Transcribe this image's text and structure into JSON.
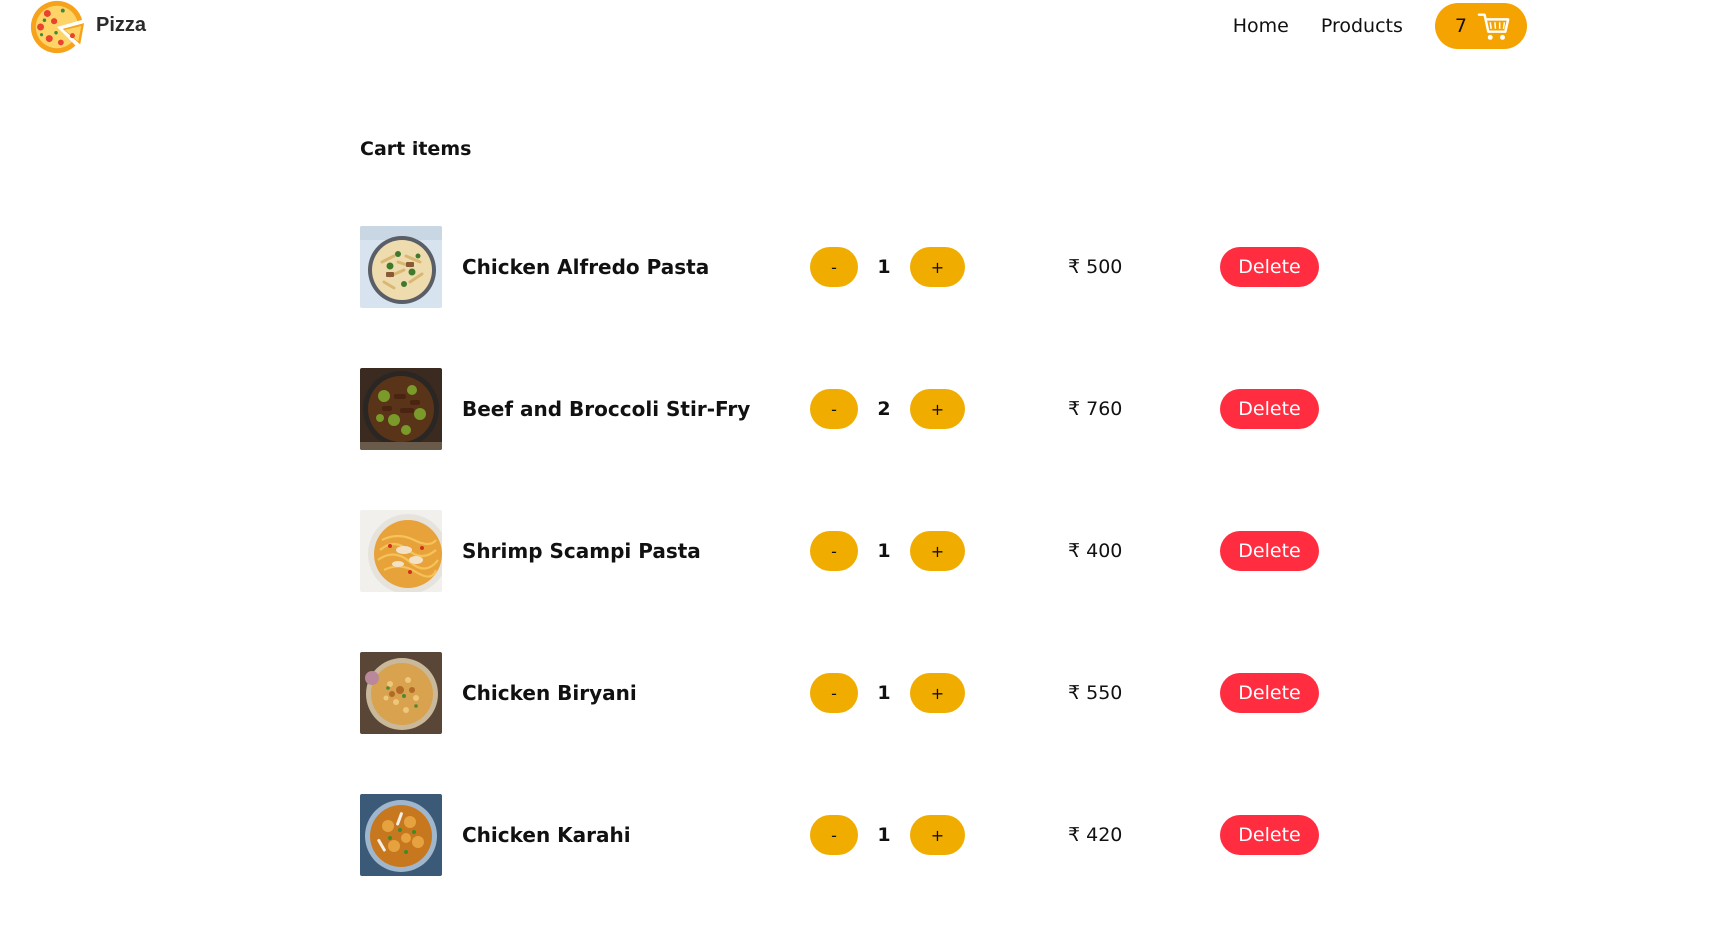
{
  "header": {
    "brand": "Pizza",
    "nav": [
      "Home",
      "Products"
    ],
    "cart_count": "7"
  },
  "cart": {
    "title": "Cart items",
    "delete_label": "Delete",
    "minus_label": "-",
    "plus_label": "+",
    "items": [
      {
        "name": "Chicken Alfredo Pasta",
        "qty": "1",
        "price": "₹ 500",
        "image": "pasta-bowl"
      },
      {
        "name": "Beef and Broccoli Stir-Fry",
        "qty": "2",
        "price": "₹ 760",
        "image": "stir-fry-pan"
      },
      {
        "name": "Shrimp Scampi Pasta",
        "qty": "1",
        "price": "₹ 400",
        "image": "spaghetti-plate"
      },
      {
        "name": "Chicken Biryani",
        "qty": "1",
        "price": "₹ 550",
        "image": "biryani-bowl"
      },
      {
        "name": "Chicken Karahi",
        "qty": "1",
        "price": "₹ 420",
        "image": "karahi-bowl"
      }
    ]
  },
  "colors": {
    "accent": "#f4a300",
    "qty_button": "#f0ad00",
    "delete": "#ff2d3f"
  }
}
